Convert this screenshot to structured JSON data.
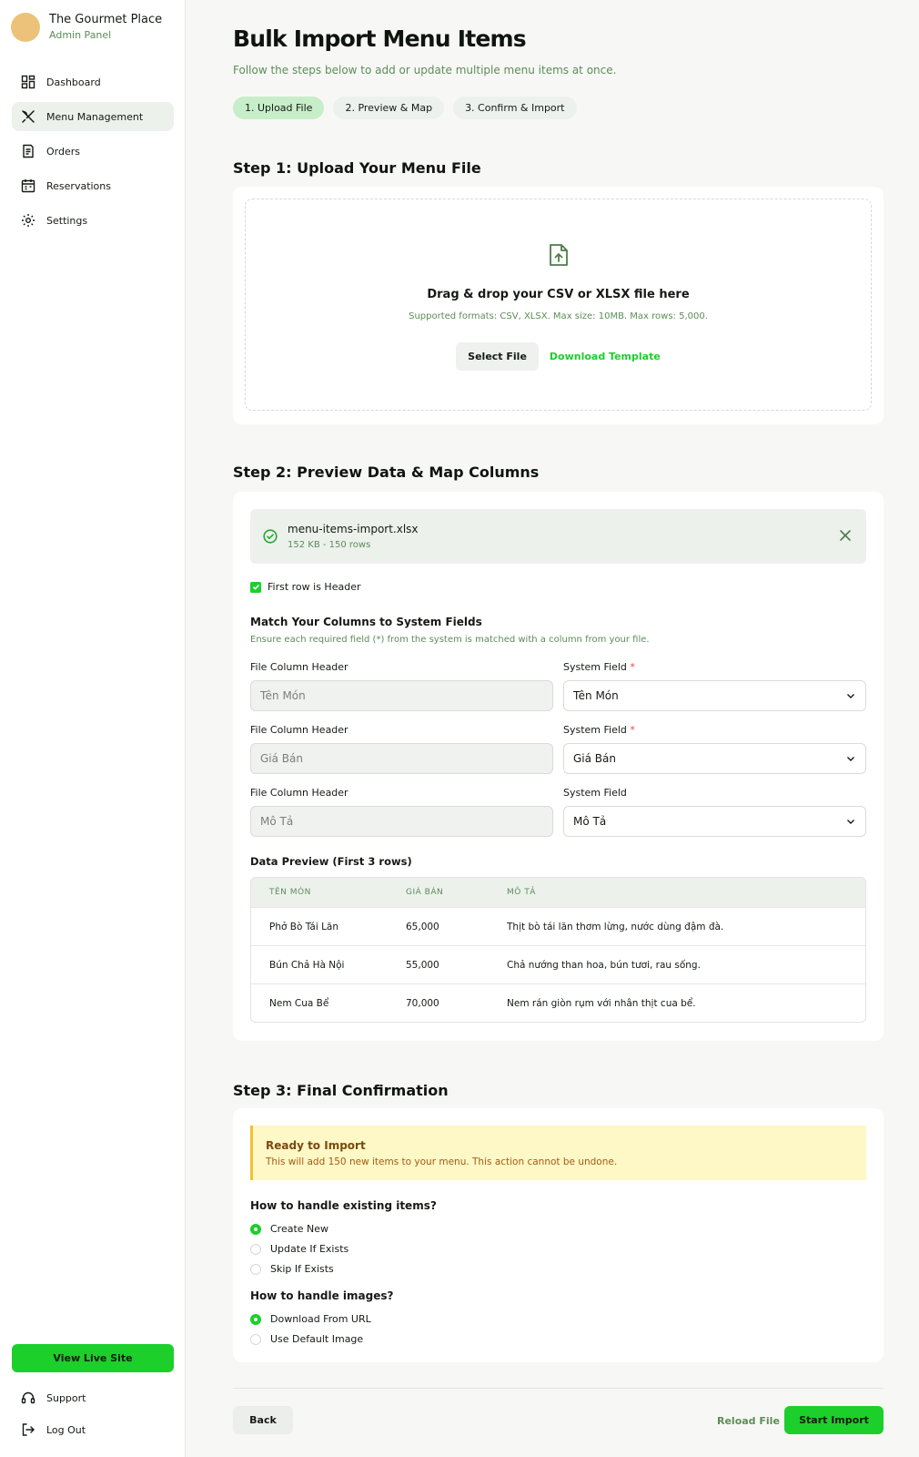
{
  "brand": {
    "name": "The Gourmet Place",
    "subtitle": "Admin Panel"
  },
  "sidebar": {
    "items": [
      {
        "label": "Dashboard",
        "icon": "dashboard-icon",
        "active": false
      },
      {
        "label": "Menu Management",
        "icon": "utensils-icon",
        "active": true
      },
      {
        "label": "Orders",
        "icon": "receipt-icon",
        "active": false
      },
      {
        "label": "Reservations",
        "icon": "calendar-icon",
        "active": false
      },
      {
        "label": "Settings",
        "icon": "gear-icon",
        "active": false
      }
    ],
    "view_live": "View Live Site",
    "support": "Support",
    "logout": "Log Out"
  },
  "header": {
    "title": "Bulk Import Menu Items",
    "subtitle": "Follow the steps below to add or update multiple menu items at once.",
    "steps": [
      "1. Upload File",
      "2. Preview & Map",
      "3. Confirm & Import"
    ],
    "active_step": 0
  },
  "step1": {
    "heading": "Step 1: Upload Your Menu File",
    "drop_title": "Drag & drop your CSV or XLSX file here",
    "drop_sub": "Supported formats: CSV, XLSX. Max size: 10MB. Max rows: 5,000.",
    "select_button": "Select File",
    "template_link": "Download Template"
  },
  "step2": {
    "heading": "Step 2: Preview Data & Map Columns",
    "file": {
      "name": "menu-items-import.xlsx",
      "meta": "152 KB - 150 rows"
    },
    "header_checkbox": {
      "label": "First row is Header",
      "checked": true
    },
    "match_title": "Match Your Columns to System Fields",
    "match_hint": "Ensure each required field (*) from the system is matched with a column from your file.",
    "mappings": [
      {
        "file_label": "File Column Header",
        "file_value": "Tên Món",
        "system_label": "System Field",
        "required": true,
        "system_value": "Tên Món"
      },
      {
        "file_label": "File Column Header",
        "file_value": "Giá Bán",
        "system_label": "System Field",
        "required": true,
        "system_value": "Giá Bán"
      },
      {
        "file_label": "File Column Header",
        "file_value": "Mô Tả",
        "system_label": "System Field",
        "required": false,
        "system_value": "Mô Tả"
      }
    ],
    "preview_title": "Data Preview (First 3 rows)",
    "preview_headers": [
      "TÊN MÓN",
      "GIÁ BÁN",
      "MÔ TẢ"
    ],
    "preview_rows": [
      [
        "Phở Bò Tái Lăn",
        "65,000",
        "Thịt bò tái lăn thơm lừng, nước dùng đậm đà."
      ],
      [
        "Bún Chả Hà Nội",
        "55,000",
        "Chả nướng than hoa, bún tươi, rau sống."
      ],
      [
        "Nem Cua Bể",
        "70,000",
        "Nem rán giòn rụm với nhân thịt cua bể."
      ]
    ]
  },
  "step3": {
    "heading": "Step 3: Final Confirmation",
    "alert_title": "Ready to Import",
    "alert_text": "This will add 150 new items to your menu. This action cannot be undone.",
    "existing_title": "How to handle existing items?",
    "existing_options": [
      "Create New",
      "Update If Exists",
      "Skip If Exists"
    ],
    "existing_selected": 0,
    "images_title": "How to handle images?",
    "images_options": [
      "Download From URL",
      "Use Default Image"
    ],
    "images_selected": 0
  },
  "footer": {
    "back": "Back",
    "reload": "Reload File",
    "start": "Start Import"
  },
  "colors": {
    "accent": "#1ccf2b",
    "muted_green": "#5d8c57",
    "active_bg": "#ecf1ec",
    "warning_bg": "#fef7c6",
    "warning_border": "#f2c230"
  }
}
